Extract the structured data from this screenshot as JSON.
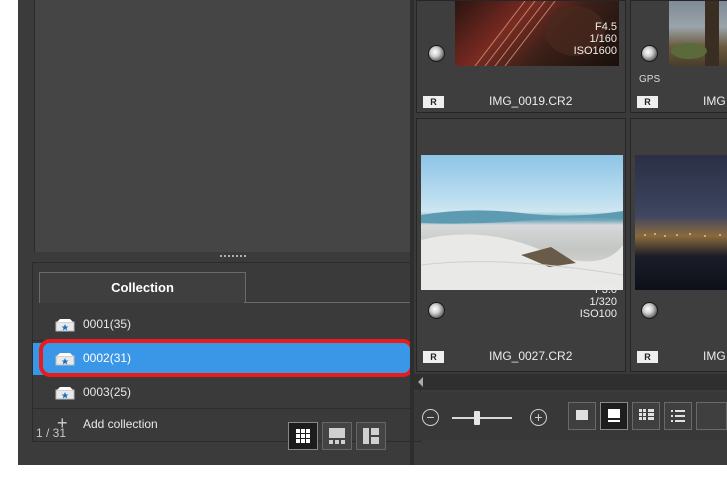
{
  "collection_panel": {
    "tab_label": "Collection",
    "items": [
      {
        "label": "0001(35)",
        "selected": false
      },
      {
        "label": "0002(31)",
        "selected": true
      },
      {
        "label": "0003(25)",
        "selected": false
      }
    ],
    "add_label": "Add collection"
  },
  "status": {
    "count": "1 / 31"
  },
  "thumbnails": [
    {
      "filename": "IMG_0019.CR2",
      "aperture": "F4.5",
      "shutter": "1/160",
      "iso": "ISO1600",
      "badge": "R"
    },
    {
      "filename": "IMG",
      "badge": "R",
      "gps": "GPS"
    },
    {
      "filename": "IMG_0027.CR2",
      "aperture": "F3.0",
      "shutter": "1/320",
      "iso": "ISO100",
      "badge": "R"
    },
    {
      "filename": "IMG",
      "badge": "R"
    }
  ],
  "colors": {
    "selection": "#3a97e8",
    "highlight_ring": "#e81c1c",
    "app_bg": "#3b3b3b"
  }
}
